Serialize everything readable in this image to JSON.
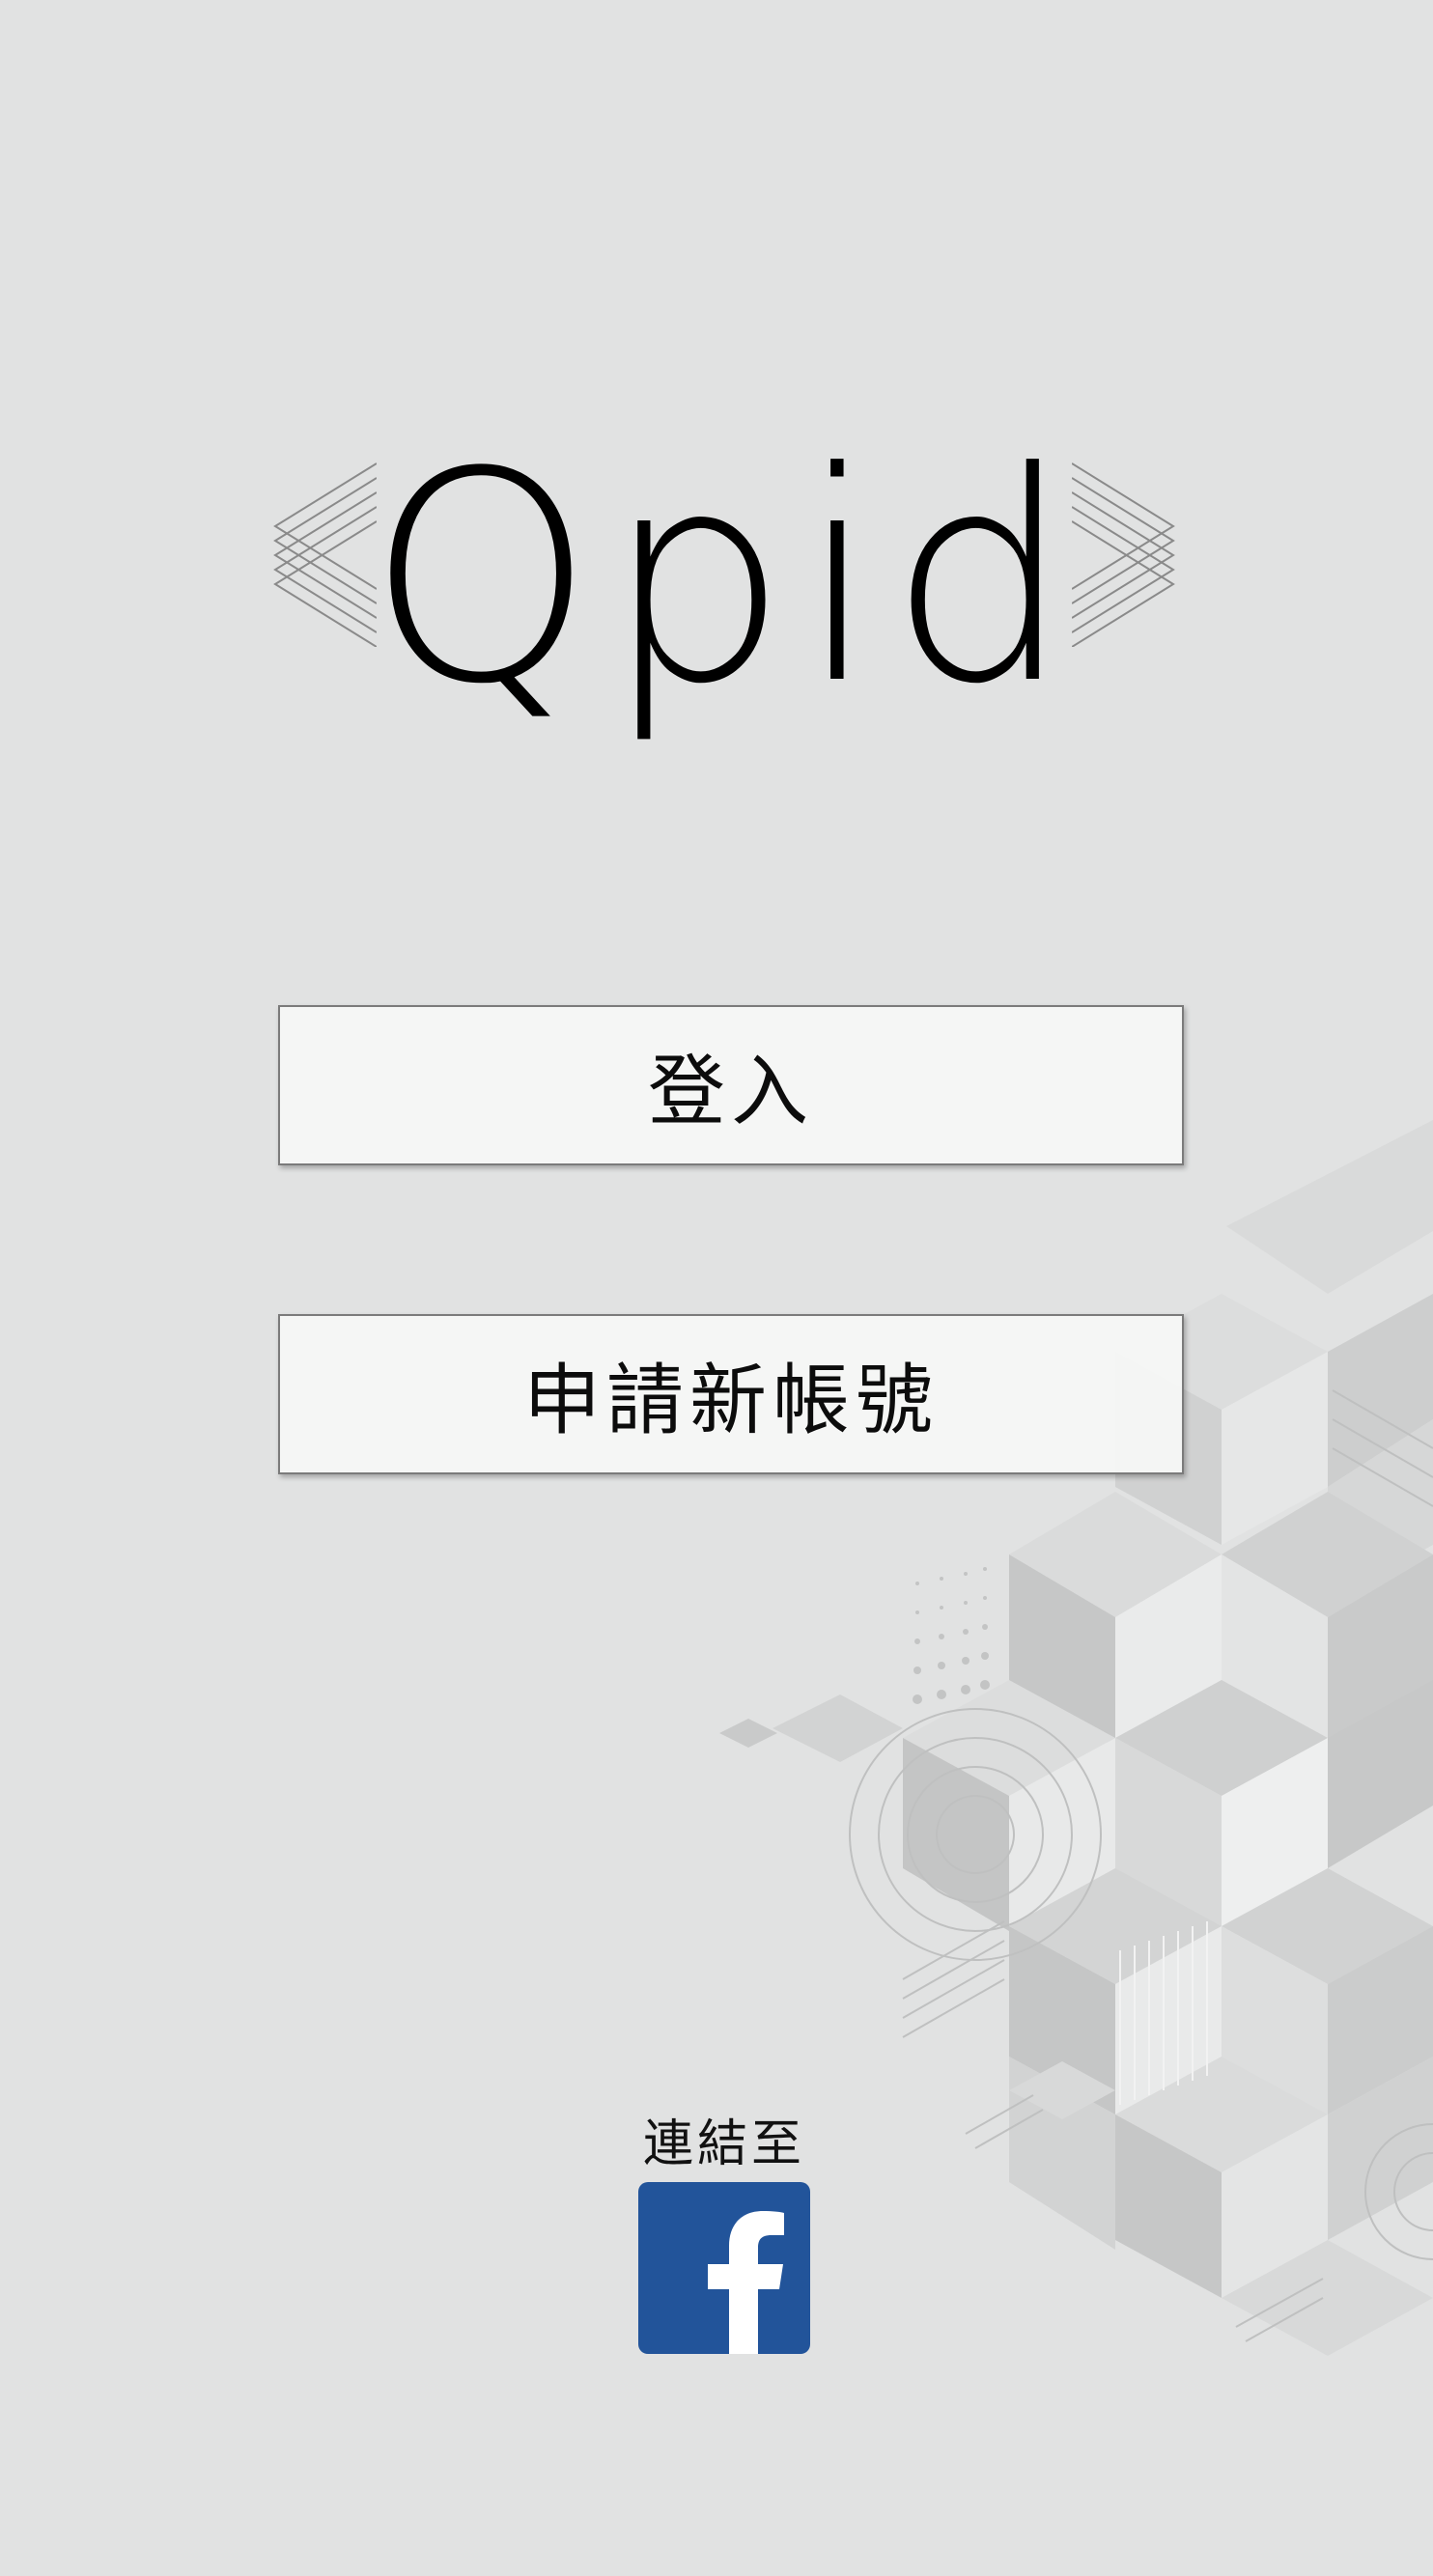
{
  "brand": {
    "logo_text": "Qpid"
  },
  "actions": {
    "login_label": "登入",
    "signup_label": "申請新帳號"
  },
  "social": {
    "connect_label": "連結至",
    "facebook_icon": "facebook-icon",
    "facebook_color": "#22549a"
  },
  "colors": {
    "background": "#e1e2e2",
    "button_fill": "#f5f6f5",
    "button_border": "#7b7b7b",
    "cube_light": "#ececec",
    "cube_mid": "#d4d5d5",
    "cube_dark": "#c3c4c4"
  }
}
